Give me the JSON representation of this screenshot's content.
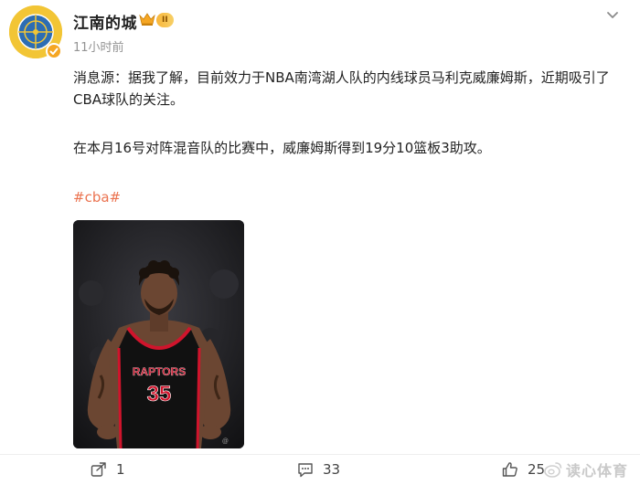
{
  "header": {
    "username": "江南的城",
    "level_badge": "II",
    "timestamp": "11小时前"
  },
  "post": {
    "paragraph1": "消息源：据我了解，目前效力于NBA南湾湖人队的内线球员马利克威廉姆斯，近期吸引了CBA球队的关注。",
    "paragraph2": "在本月16号对阵混音队的比赛中，威廉姆斯得到19分10篮板3助攻。",
    "hashtag": "#cba#",
    "image_jersey_team": "RAPTORS",
    "image_jersey_number": "35"
  },
  "actions": {
    "share_count": "1",
    "comment_count": "33",
    "like_count": "25"
  },
  "watermark": {
    "text": "读心体育"
  },
  "icons": {
    "more": "chevron-down-icon",
    "share": "share-icon",
    "comment": "comment-icon",
    "like": "thumbs-up-icon"
  },
  "colors": {
    "accent": "#eb7350",
    "secondary_text": "#939393",
    "badge_gold": "#f9b63a",
    "jersey_black": "#111111",
    "jersey_red": "#d0142c"
  }
}
